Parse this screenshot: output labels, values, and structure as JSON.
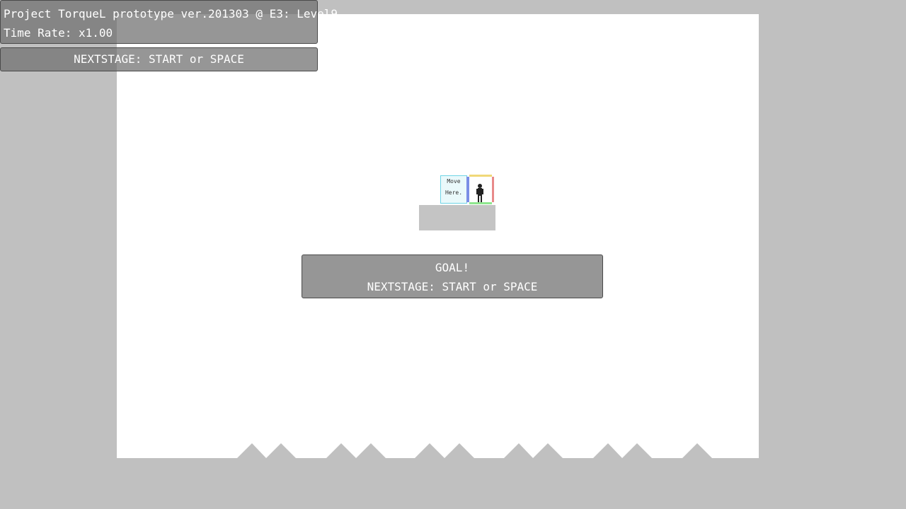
{
  "hud": {
    "title": "Project TorqueL prototype ver.201303 @ E3: Level9",
    "time_rate": "Time Rate: x1.00",
    "next_stage_hint": "NEXTSTAGE: START or SPACE"
  },
  "goal_marker": {
    "line1": "Move",
    "line2": "Here."
  },
  "goal_dialog": {
    "heading": "GOAL!",
    "prompt": "NEXTSTAGE: START or SPACE"
  },
  "colors": {
    "background": "#c0c0c0",
    "stage": "#ffffff",
    "platform": "#c4c4c4",
    "edge_top": "#f0d878",
    "edge_left": "#7b8ee6",
    "edge_right": "#e88a8a",
    "edge_bottom": "#8ee68e",
    "goal_border": "#6fd4e6"
  }
}
